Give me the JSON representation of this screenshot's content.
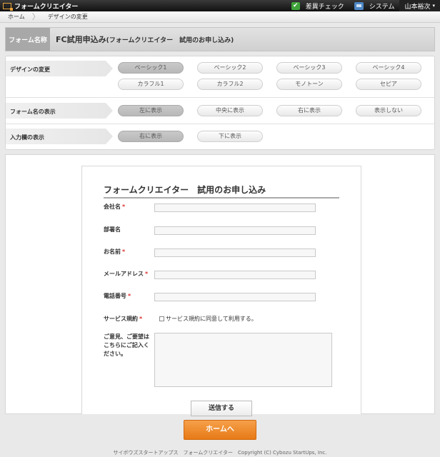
{
  "topbar": {
    "app_title": "フォームクリエイター",
    "items": [
      {
        "label": "差異チェック",
        "icon": "check-icon"
      },
      {
        "label": "システム",
        "icon": "system-icon"
      }
    ],
    "user_name": "山本裕次",
    "user_caret": "▾"
  },
  "breadcrumb": {
    "items": [
      "ホーム",
      "デザインの変更"
    ]
  },
  "form_name_bar": {
    "label": "フォーム名称",
    "value_main": "FC試用申込み",
    "value_sub": "(フォームクリエイター　試用のお申し込み)"
  },
  "settings": {
    "design": {
      "label": "デザインの変更",
      "options": [
        "ベーシック1",
        "ベーシック2",
        "ベーシック3",
        "ベーシック4",
        "カラフル1",
        "カラフル2",
        "モノトーン",
        "セピア"
      ],
      "selected": "ベーシック1"
    },
    "form_name_display": {
      "label": "フォーム名の表示",
      "options": [
        "左に表示",
        "中央に表示",
        "右に表示",
        "表示しない"
      ],
      "selected": "左に表示"
    },
    "input_display": {
      "label": "入力欄の表示",
      "options": [
        "右に表示",
        "下に表示"
      ],
      "selected": "右に表示"
    }
  },
  "preview": {
    "title": "フォームクリエイター　試用のお申し込み",
    "fields": [
      {
        "label": "会社名",
        "required": true
      },
      {
        "label": "部署名",
        "required": false
      },
      {
        "label": "お名前",
        "required": true
      },
      {
        "label": "メールアドレス",
        "required": true
      },
      {
        "label": "電話番号",
        "required": true
      }
    ],
    "terms_label": "サービス規約",
    "terms_checkbox_text": "サービス規約に同意して利用する。",
    "comments_label": "ご意見、ご要望はこちらにご記入ください。",
    "required_mark": "*",
    "submit_label": "送信する"
  },
  "home_button": "ホームへ",
  "footer": "サイボウズスタートアップス　フォームクリエイター　Copyright (C) Cybozu StartUps, Inc.",
  "colors": {
    "accent_orange": "#e77a17",
    "check_green": "#3fa33a",
    "required_red": "#d33333"
  }
}
